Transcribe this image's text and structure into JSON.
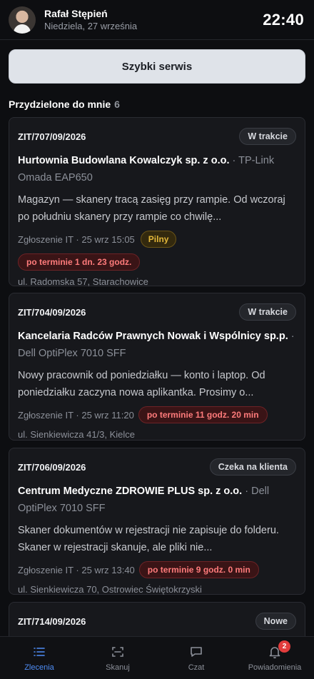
{
  "header": {
    "user_name": "Rafał Stępień",
    "date": "Niedziela, 27 września",
    "time": "22:40"
  },
  "quick_service_label": "Szybki serwis",
  "section": {
    "title": "Przydzielone do mnie",
    "count": "6"
  },
  "tickets": [
    {
      "id": "ZIT/707/09/2026",
      "status": "W trakcie",
      "client": "Hurtownia Budowlana Kowalczyk sp. z o.o.",
      "device": "· TP-Link Omada EAP650",
      "description": "Magazyn — skanery tracą zasięg przy rampie. Od wczoraj po południu skanery przy rampie co chwilę...",
      "meta": "Zgłoszenie IT · 25 wrz 15:05",
      "priority": "Pilny",
      "overdue": "po terminie 1 dn. 23 godz.",
      "address": "ul. Radomska 57, Starachowice"
    },
    {
      "id": "ZIT/704/09/2026",
      "status": "W trakcie",
      "client": "Kancelaria Radców Prawnych Nowak i Wspólnicy sp.p.",
      "device": "· Dell OptiPlex 7010 SFF",
      "description": "Nowy pracownik od poniedziałku — konto i laptop. Od poniedziałku zaczyna nowa aplikantka. Prosimy o...",
      "meta": "Zgłoszenie IT · 25 wrz 11:20",
      "overdue": "po terminie 11 godz. 20 min",
      "address": "ul. Sienkiewicza 41/3, Kielce"
    },
    {
      "id": "ZIT/706/09/2026",
      "status": "Czeka na klienta",
      "client": "Centrum Medyczne ZDROWIE PLUS sp. z o.o.",
      "device": "· Dell OptiPlex 7010 SFF",
      "description": "Skaner dokumentów w rejestracji nie zapisuje do folderu. Skaner w rejestracji skanuje, ale pliki nie...",
      "meta": "Zgłoszenie IT · 25 wrz 13:40",
      "overdue": "po terminie 9 godz. 0 min",
      "address": "ul. Sienkiewicza 70, Ostrowiec Świętokrzyski"
    },
    {
      "id": "ZIT/714/09/2026",
      "status": "Nowe"
    }
  ],
  "nav": {
    "orders": "Zlecenia",
    "scan": "Skanuj",
    "chat": "Czat",
    "notifications": "Powiadomienia",
    "notifications_count": "2"
  },
  "colors": {
    "accent": "#4f8ef7",
    "overdue": "#ff7b7b",
    "urgent": "#e3b73a"
  }
}
